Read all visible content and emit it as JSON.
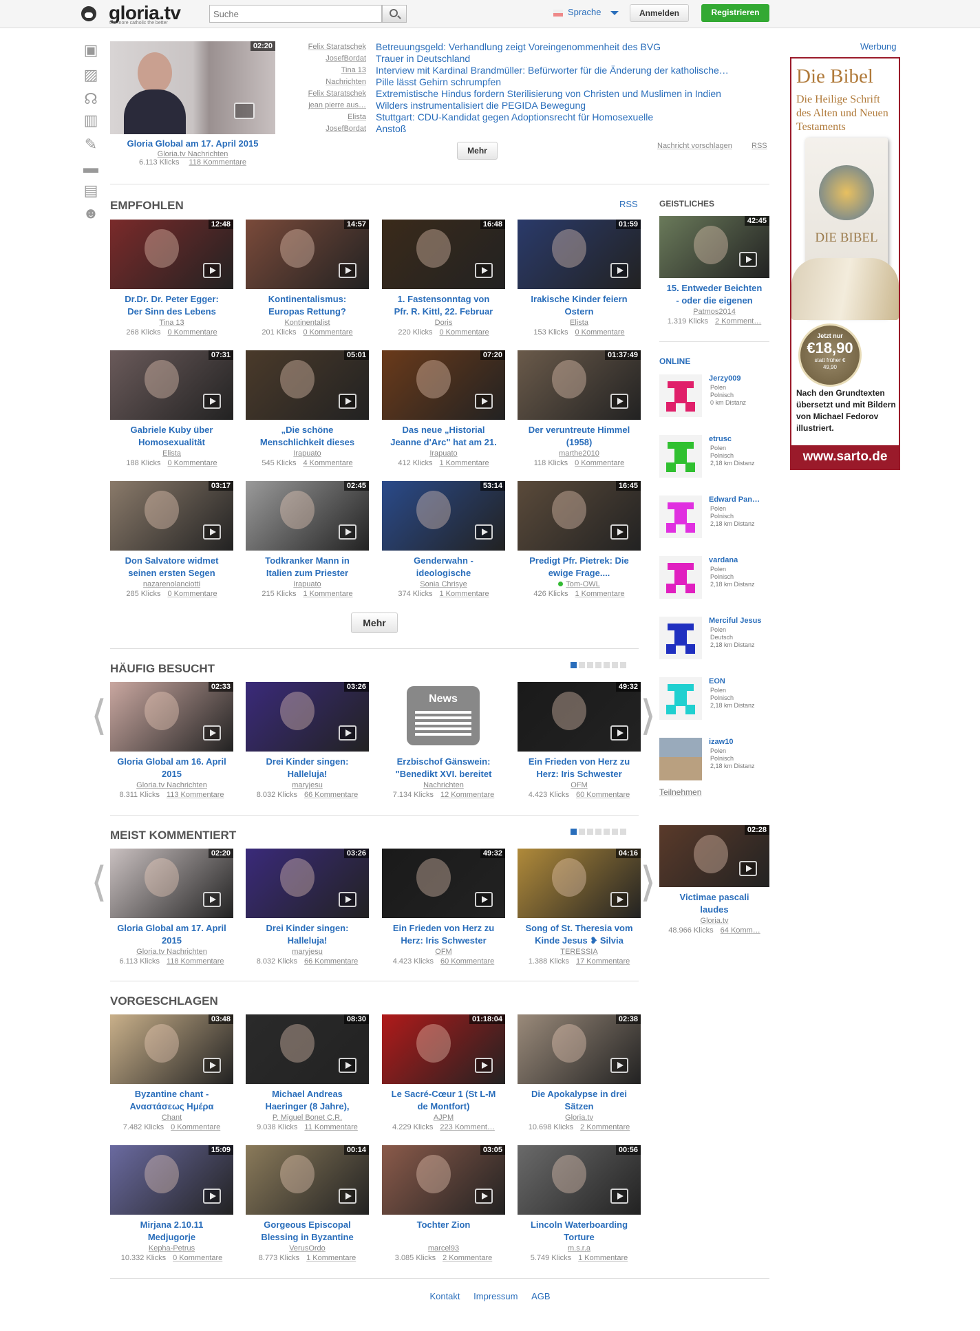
{
  "header": {
    "logo": "gloria.tv",
    "tagline": "the more catholic the better",
    "search_placeholder": "Suche",
    "language": "Sprache",
    "login": "Anmelden",
    "register": "Registrieren"
  },
  "featured": {
    "duration": "02:20",
    "title": "Gloria Global am 17. April 2015",
    "author": "Gloria.tv Nachrichten",
    "clicks": "6.113 Klicks",
    "comments": "118 Kommentare"
  },
  "news": [
    {
      "author": "Felix Staratschek",
      "title": "Betreuungsgeld: Verhandlung zeigt Voreingenommenheit des BVG"
    },
    {
      "author": "JosefBordat",
      "title": "Trauer in Deutschland"
    },
    {
      "author": "Tina 13",
      "title": "Interview mit Kardinal Brandmüller: Befürworter für die Änderung der katholische…"
    },
    {
      "author": "Nachrichten",
      "title": "Pille lässt Gehirn schrumpfen"
    },
    {
      "author": "Felix Staratschek",
      "title": "Extremistische Hindus fordern Sterilisierung von Christen und Muslimen in Indien"
    },
    {
      "author": "jean pierre aus…",
      "title": "Wilders instrumentalisiert die PEGIDA Bewegung"
    },
    {
      "author": "Elista",
      "title": "Stuttgart: CDU-Kandidat gegen Adoptionsrecht für Homosexuelle"
    },
    {
      "author": "JosefBordat",
      "title": "Anstoß"
    }
  ],
  "news_more": "Mehr",
  "news_suggest": "Nachricht vorschlagen",
  "news_rss": "RSS",
  "ad_label": "Werbung",
  "ad": {
    "title": "Die Bibel",
    "subtitle": "Die Heilige Schrift des Alten und Neuen Testaments",
    "book": "DIE BIBEL",
    "price_pre": "Jetzt nur",
    "price": "€18,90",
    "price_old": "statt früher € 49,90",
    "desc": "Nach den Grundtexten übersetzt und mit Bildern von Michael Fedorov illustriert.",
    "url": "www.sarto.de"
  },
  "recommended": {
    "heading": "EMPFOHLEN",
    "rss": "RSS",
    "more": "Mehr",
    "items": [
      {
        "d": "12:48",
        "t1": "Dr.Dr. Dr. Peter Egger:",
        "t2": "Der Sinn des Lebens",
        "a": "Tina 13",
        "k": "268 Klicks",
        "c": "0 Kommentare",
        "bg": "#7a2a2a"
      },
      {
        "d": "14:57",
        "t1": "Kontinentalismus:",
        "t2": "Europas Rettung?",
        "a": "Kontinentalist",
        "k": "201 Klicks",
        "c": "0 Kommentare",
        "bg": "#7a4a3a"
      },
      {
        "d": "16:48",
        "t1": "1. Fastensonntag von",
        "t2": "Pfr. R. Kittl, 22. Februar",
        "a": "Doris",
        "k": "220 Klicks",
        "c": "0 Kommentare",
        "bg": "#3a2a1a"
      },
      {
        "d": "01:59",
        "t1": "Irakische Kinder feiern",
        "t2": "Ostern",
        "a": "Elista",
        "k": "153 Klicks",
        "c": "0 Kommentare",
        "bg": "#2a3a6a"
      },
      {
        "d": "07:31",
        "t1": "Gabriele Kuby über",
        "t2": "Homosexualität",
        "a": "Elista",
        "k": "188 Klicks",
        "c": "0 Kommentare",
        "bg": "#6a5a5a"
      },
      {
        "d": "05:01",
        "t1": "„Die schöne",
        "t2": "Menschlichkeit dieses",
        "a": "Irapuato",
        "k": "545 Klicks",
        "c": "4 Kommentare",
        "bg": "#4a3a2a"
      },
      {
        "d": "07:20",
        "t1": "Das neue „Historial",
        "t2": "Jeanne d'Arc\" hat am 21.",
        "a": "Irapuato",
        "k": "412 Klicks",
        "c": "1 Kommentare",
        "bg": "#6a3a1a"
      },
      {
        "d": "01:37:49",
        "t1": "Der veruntreute Himmel",
        "t2": "(1958)",
        "a": "marthe2010",
        "k": "118 Klicks",
        "c": "0 Kommentare",
        "bg": "#6a5a4a"
      },
      {
        "d": "03:17",
        "t1": "Don Salvatore widmet",
        "t2": "seinen ersten Segen",
        "a": "nazarenolanciotti",
        "k": "285 Klicks",
        "c": "0 Kommentare",
        "bg": "#8a7a6a"
      },
      {
        "d": "02:45",
        "t1": "Todkranker Mann in",
        "t2": "Italien zum Priester",
        "a": "Irapuato",
        "k": "215 Klicks",
        "c": "1 Kommentare",
        "bg": "#9a9a9a"
      },
      {
        "d": "53:14",
        "t1": "Genderwahn -",
        "t2": "ideologische",
        "a": "Sonia Chrisye",
        "k": "374 Klicks",
        "c": "1 Kommentare",
        "bg": "#2a4a8a"
      },
      {
        "d": "16:45",
        "t1": "Predigt Pfr. Pietrek: Die",
        "t2": "ewige Frage....",
        "a": "Tom-OWL",
        "k": "426 Klicks",
        "c": "1 Kommentare",
        "bg": "#5a4a3a"
      }
    ]
  },
  "frequent": {
    "heading": "HÄUFIG BESUCHT",
    "items": [
      {
        "d": "02:33",
        "t1": "Gloria Global am 16. April",
        "t2": "2015",
        "a": "Gloria.tv Nachrichten",
        "k": "8.311 Klicks",
        "c": "113 Kommentare",
        "bg": "#c9a7a0"
      },
      {
        "d": "03:26",
        "t1": "Drei Kinder singen:",
        "t2": "Halleluja!",
        "a": "maryjesu",
        "k": "8.032 Klicks",
        "c": "66 Kommentare",
        "bg": "#3a2a7a"
      },
      {
        "d": "",
        "t1": "Erzbischof Gänswein:",
        "t2": "\"Benedikt XVI. bereitet",
        "a": "Nachrichten",
        "k": "7.134 Klicks",
        "c": "12 Kommentare",
        "bg": "#fff",
        "news": "News"
      },
      {
        "d": "49:32",
        "t1": "Ein Frieden von Herz zu",
        "t2": "Herz: Iris Schwester",
        "a": "OFM",
        "k": "4.423 Klicks",
        "c": "60 Kommentare",
        "bg": "#1a1a1a"
      }
    ]
  },
  "commented": {
    "heading": "MEIST KOMMENTIERT",
    "items": [
      {
        "d": "02:20",
        "t1": "Gloria Global am 17. April",
        "t2": "2015",
        "a": "Gloria.tv Nachrichten",
        "k": "6.113 Klicks",
        "c": "118 Kommentare",
        "bg": "#c9c0c0"
      },
      {
        "d": "03:26",
        "t1": "Drei Kinder singen:",
        "t2": "Halleluja!",
        "a": "maryjesu",
        "k": "8.032 Klicks",
        "c": "66 Kommentare",
        "bg": "#3a2a7a"
      },
      {
        "d": "49:32",
        "t1": "Ein Frieden von Herz zu",
        "t2": "Herz: Iris Schwester",
        "a": "OFM",
        "k": "4.423 Klicks",
        "c": "60 Kommentare",
        "bg": "#1a1a1a"
      },
      {
        "d": "04:16",
        "t1": "Song of St. Theresia vom",
        "t2": "Kinde Jesus ❥ Silvia",
        "a": "TERESSIA",
        "k": "1.388 Klicks",
        "c": "17 Kommentare",
        "bg": "#b08a3a"
      }
    ]
  },
  "suggested": {
    "heading": "VORGESCHLAGEN",
    "items": [
      {
        "d": "03:48",
        "t1": "Byzantine chant -",
        "t2": "Αναστάσεως Ημέρα",
        "a": "Chant",
        "k": "7.482 Klicks",
        "c": "0 Kommentare",
        "bg": "#c9b08a"
      },
      {
        "d": "08:30",
        "t1": "Michael Andreas",
        "t2": "Haeringer (8 Jahre),",
        "a": "P. Miguel Bonet C.R.",
        "k": "9.038 Klicks",
        "c": "11 Kommentare",
        "bg": "#2a2a2a"
      },
      {
        "d": "01:18:04",
        "t1": "Le Sacré-Cœur 1 (St L-M",
        "t2": "de Montfort)",
        "a": "AJPM",
        "k": "4.229 Klicks",
        "c": "223 Komment…",
        "bg": "#b01a1a"
      },
      {
        "d": "02:38",
        "t1": "Die Apokalypse in drei",
        "t2": "Sätzen",
        "a": "Gloria.tv",
        "k": "10.698 Klicks",
        "c": "2 Kommentare",
        "bg": "#9a8a7a"
      },
      {
        "d": "15:09",
        "t1": "Mirjana 2.10.11",
        "t2": "Medjugorje",
        "a": "Kepha-Petrus",
        "k": "10.332 Klicks",
        "c": "0 Kommentare",
        "bg": "#6a6aa0"
      },
      {
        "d": "00:14",
        "t1": "Gorgeous Episcopal",
        "t2": "Blessing in Byzantine",
        "a": "VerusOrdo",
        "k": "8.773 Klicks",
        "c": "1 Kommentare",
        "bg": "#8a7a5a"
      },
      {
        "d": "03:05",
        "t1": "Tochter Zion",
        "t2": "",
        "a": "marcel93",
        "k": "3.085 Klicks",
        "c": "2 Kommentare",
        "bg": "#8a5a4a"
      },
      {
        "d": "00:56",
        "t1": "Lincoln Waterboarding",
        "t2": "Torture",
        "a": "m.s.r.a",
        "k": "5.749 Klicks",
        "c": "1 Kommentare",
        "bg": "#6a6a6a"
      }
    ]
  },
  "spiritual": {
    "heading": "GEISTLICHES",
    "d": "42:45",
    "t1": "15. Entweder Beichten",
    "t2": "- oder die eigenen",
    "a": "Patmos2014",
    "k": "1.319 Klicks",
    "c": "2 Komment…",
    "bg": "#6a7a5a"
  },
  "online": {
    "heading": "ONLINE",
    "join": "Teilnehmen",
    "users": [
      {
        "name": "Jerzy009",
        "l1": "Polen",
        "l2": "Polnisch",
        "l3": "0 km Distanz",
        "color": "#e0206a"
      },
      {
        "name": "etrusc",
        "l1": "Polen",
        "l2": "Polnisch",
        "l3": "2,18 km Distanz",
        "color": "#30c030"
      },
      {
        "name": "Edward Pan…",
        "l1": "Polen",
        "l2": "Polnisch",
        "l3": "2,18 km Distanz",
        "color": "#e030e0"
      },
      {
        "name": "vardana",
        "l1": "Polen",
        "l2": "Polnisch",
        "l3": "2,18 km Distanz",
        "color": "#e020c0"
      },
      {
        "name": "Merciful Jesus",
        "l1": "Polen",
        "l2": "Deutsch",
        "l3": "2,18 km Distanz",
        "color": "#2030c0"
      },
      {
        "name": "EON",
        "l1": "Polen",
        "l2": "Polnisch",
        "l3": "2,18 km Distanz",
        "color": "#20d0d0"
      },
      {
        "name": "izaw10",
        "l1": "Polen",
        "l2": "Polnisch",
        "l3": "2,18 km Distanz",
        "color": "photo"
      }
    ]
  },
  "right_video": {
    "d": "02:28",
    "t1": "Victimae pascali",
    "t2": "laudes",
    "a": "Gloria.tv",
    "k": "48.966 Klicks",
    "c": "64 Komm…",
    "bg": "#5a3a2a"
  },
  "footer": {
    "contact": "Kontakt",
    "imprint": "Impressum",
    "terms": "AGB"
  }
}
